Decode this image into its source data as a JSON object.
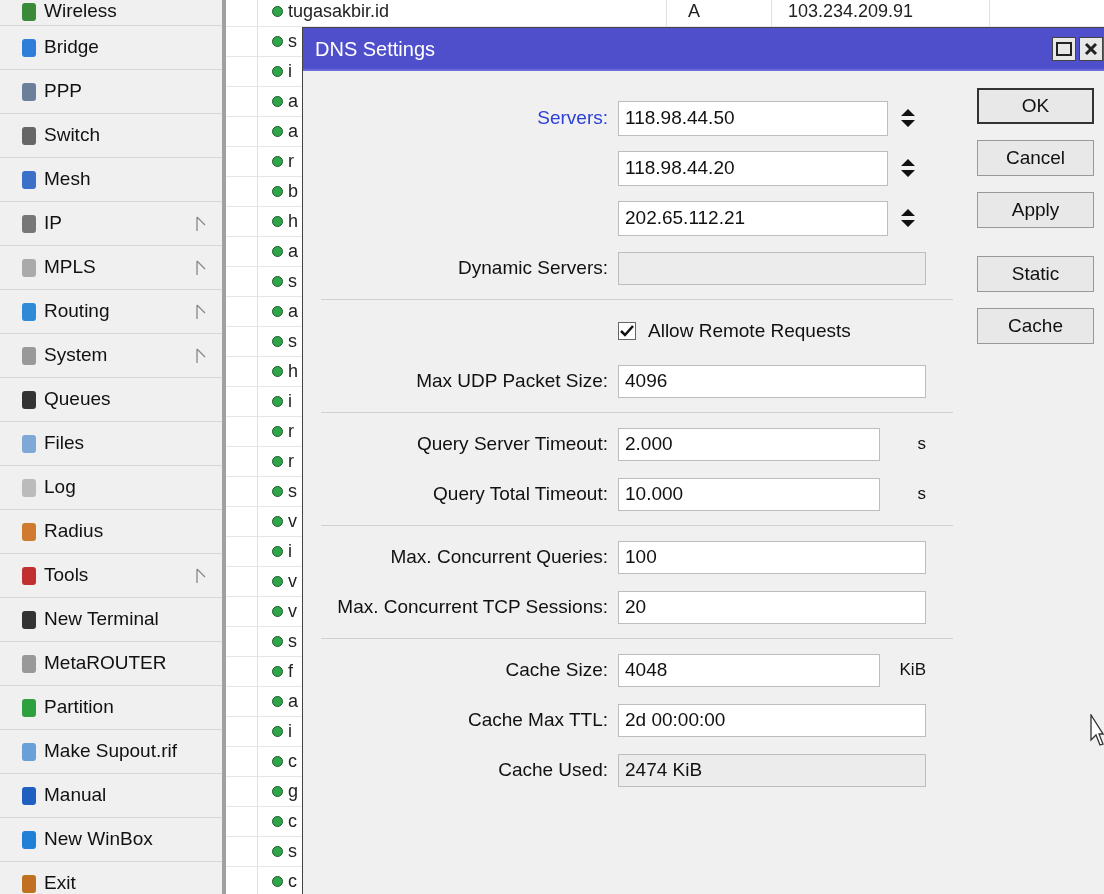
{
  "sidebar": {
    "items": [
      {
        "label": "Wireless",
        "submenu": false
      },
      {
        "label": "Bridge",
        "submenu": false
      },
      {
        "label": "PPP",
        "submenu": false
      },
      {
        "label": "Switch",
        "submenu": false
      },
      {
        "label": "Mesh",
        "submenu": false
      },
      {
        "label": "IP",
        "submenu": true
      },
      {
        "label": "MPLS",
        "submenu": true
      },
      {
        "label": "Routing",
        "submenu": true
      },
      {
        "label": "System",
        "submenu": true
      },
      {
        "label": "Queues",
        "submenu": false
      },
      {
        "label": "Files",
        "submenu": false
      },
      {
        "label": "Log",
        "submenu": false
      },
      {
        "label": "Radius",
        "submenu": false
      },
      {
        "label": "Tools",
        "submenu": true
      },
      {
        "label": "New Terminal",
        "submenu": false
      },
      {
        "label": "MetaROUTER",
        "submenu": false
      },
      {
        "label": "Partition",
        "submenu": false
      },
      {
        "label": "Make Supout.rif",
        "submenu": false
      },
      {
        "label": "Manual",
        "submenu": false
      },
      {
        "label": "New WinBox",
        "submenu": false
      },
      {
        "label": "Exit",
        "submenu": false
      }
    ]
  },
  "dns_list": {
    "rows": [
      {
        "name": "tugasakbir.id",
        "type": "A",
        "address": "103.234.209.91"
      },
      {
        "name": "s"
      },
      {
        "name": "i"
      },
      {
        "name": "a"
      },
      {
        "name": "a"
      },
      {
        "name": "r"
      },
      {
        "name": "b"
      },
      {
        "name": "h"
      },
      {
        "name": "a"
      },
      {
        "name": "s"
      },
      {
        "name": "a"
      },
      {
        "name": "s"
      },
      {
        "name": "h"
      },
      {
        "name": "i"
      },
      {
        "name": "r"
      },
      {
        "name": "r"
      },
      {
        "name": "s"
      },
      {
        "name": "v"
      },
      {
        "name": "i"
      },
      {
        "name": "v"
      },
      {
        "name": "v"
      },
      {
        "name": "s"
      },
      {
        "name": "f"
      },
      {
        "name": "a"
      },
      {
        "name": "i"
      },
      {
        "name": "c"
      },
      {
        "name": "g"
      },
      {
        "name": "c"
      },
      {
        "name": "s"
      },
      {
        "name": "c"
      }
    ]
  },
  "dialog": {
    "title": "DNS Settings",
    "sections": [
      {
        "rows": [
          {
            "kind": "server",
            "label": "Servers:",
            "value": "118.98.44.50"
          },
          {
            "kind": "server",
            "value": "118.98.44.20"
          },
          {
            "kind": "server",
            "value": "202.65.112.21"
          },
          {
            "kind": "readonly",
            "label": "Dynamic Servers:"
          }
        ]
      },
      {
        "rows": [
          {
            "kind": "checkbox",
            "label": "Allow Remote Requests",
            "checked": true
          },
          {
            "kind": "field",
            "label": "Max UDP Packet Size:",
            "value": "4096"
          }
        ]
      },
      {
        "rows": [
          {
            "kind": "field",
            "label": "Query Server Timeout:",
            "value": "2.000",
            "unit": "s"
          },
          {
            "kind": "field",
            "label": "Query Total Timeout:",
            "value": "10.000",
            "unit": "s"
          }
        ]
      },
      {
        "rows": [
          {
            "kind": "field",
            "label": "Max. Concurrent Queries:",
            "value": "100"
          },
          {
            "kind": "field",
            "label": "Max. Concurrent TCP Sessions:",
            "value": "20"
          }
        ]
      },
      {
        "rows": [
          {
            "kind": "field",
            "label": "Cache Size:",
            "value": "4048",
            "unit": "KiB"
          },
          {
            "kind": "field",
            "label": "Cache Max TTL:",
            "value": "2d 00:00:00"
          },
          {
            "kind": "readonly",
            "label": "Cache Used:",
            "value": "2474 KiB"
          }
        ]
      }
    ],
    "buttons": [
      {
        "label": "OK",
        "default": true
      },
      {
        "label": "Cancel",
        "default": false
      },
      {
        "label": "Apply",
        "default": false
      },
      {
        "label": "Static",
        "default": false,
        "gap_before": true
      },
      {
        "label": "Cache",
        "default": false
      }
    ]
  }
}
